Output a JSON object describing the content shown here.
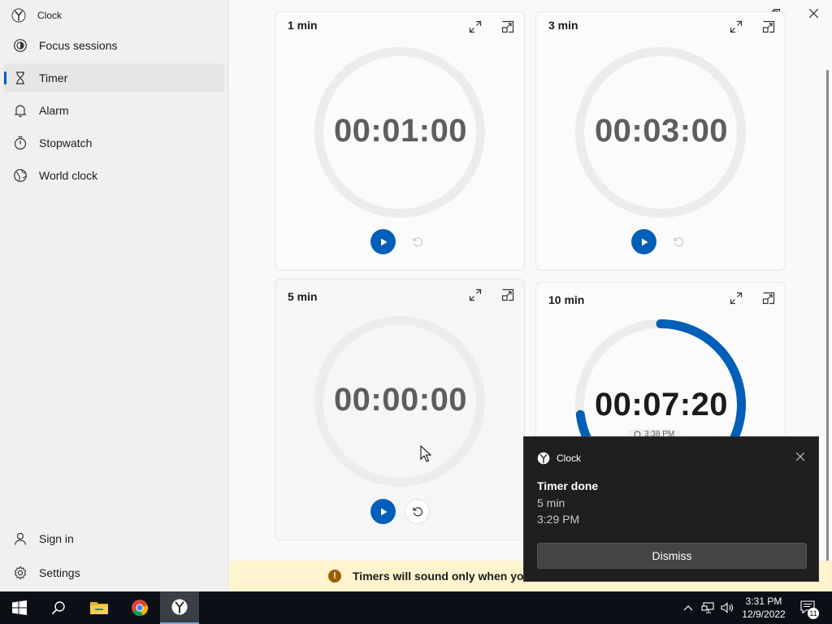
{
  "app": {
    "title": "Clock"
  },
  "sidebar": {
    "items": [
      {
        "label": "Focus sessions",
        "icon": "focus-icon"
      },
      {
        "label": "Timer",
        "icon": "hourglass-icon",
        "active": true
      },
      {
        "label": "Alarm",
        "icon": "bell-icon"
      },
      {
        "label": "Stopwatch",
        "icon": "stopwatch-icon"
      },
      {
        "label": "World clock",
        "icon": "globe-icon"
      }
    ],
    "bottom": [
      {
        "label": "Sign in",
        "icon": "person-icon"
      },
      {
        "label": "Settings",
        "icon": "gear-icon"
      }
    ]
  },
  "timers": [
    {
      "name": "1 min",
      "time": "00:01:00",
      "running": false
    },
    {
      "name": "3 min",
      "time": "00:03:00",
      "running": false
    },
    {
      "name": "5 min",
      "time": "00:00:00",
      "running": false
    },
    {
      "name": "10 min",
      "time": "00:07:20",
      "running": true,
      "progress": 0.73,
      "end_time": "3:38 PM"
    }
  ],
  "banner": {
    "text": "Timers will sound only when you"
  },
  "toast": {
    "app": "Clock",
    "title": "Timer done",
    "line1": "5 min",
    "line2": "3:29 PM",
    "dismiss": "Dismiss"
  },
  "taskbar": {
    "time": "3:31 PM",
    "date": "12/9/2022",
    "notifications": "11"
  },
  "colors": {
    "accent": "#005fb8",
    "warning_bg": "#fff4ce",
    "toast_bg": "#1f1f1f"
  }
}
